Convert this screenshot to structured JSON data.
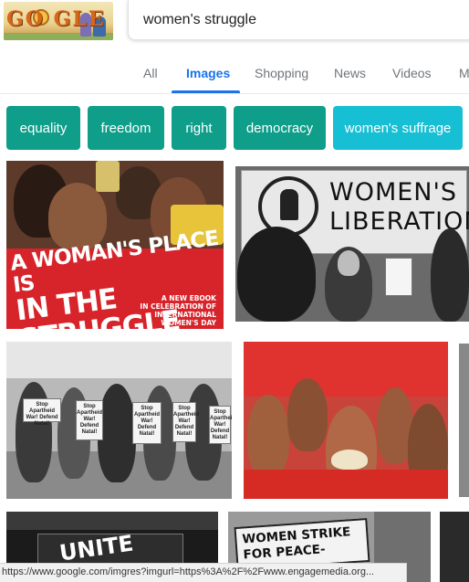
{
  "header": {
    "doodle_letters": "GO  GLE",
    "search_value": "women's struggle"
  },
  "tabs": [
    {
      "label": "All",
      "active": false
    },
    {
      "label": "Images",
      "active": true
    },
    {
      "label": "Shopping",
      "active": false
    },
    {
      "label": "News",
      "active": false
    },
    {
      "label": "Videos",
      "active": false
    },
    {
      "label": "M",
      "active": false
    }
  ],
  "chips": [
    {
      "label": "equality"
    },
    {
      "label": "freedom"
    },
    {
      "label": "right"
    },
    {
      "label": "democracy"
    },
    {
      "label": "women's suffrage"
    }
  ],
  "results": {
    "poster1": {
      "headline_line1": "A WOMAN'S PLACE IS",
      "headline_line2": "IN THE STRUGGLE",
      "sub_line1": "A NEW EBOOK",
      "sub_line2": "IN CELEBRATION OF",
      "sub_line3": "INTERNATIONAL WOMEN'S DAY"
    },
    "banner2": {
      "line1": "WOMEN'S",
      "line2": "LIBERATION"
    },
    "march3": {
      "sign_text": "Stop Apartheid War! Defend Natal!"
    },
    "strike": {
      "line1": "WOMEN STRIKE",
      "line2": "FOR PEACE-"
    },
    "unite": {
      "text": "UNITE"
    }
  },
  "status_bar": {
    "url": "https://www.google.com/imgres?imgurl=https%3A%2F%2Fwww.engagemedia.org..."
  },
  "colors": {
    "accent_blue": "#1a73e8",
    "chip_teal": "#0e9e8a",
    "chip_cyan": "#16bfd3",
    "poster_red": "#d7232a"
  }
}
